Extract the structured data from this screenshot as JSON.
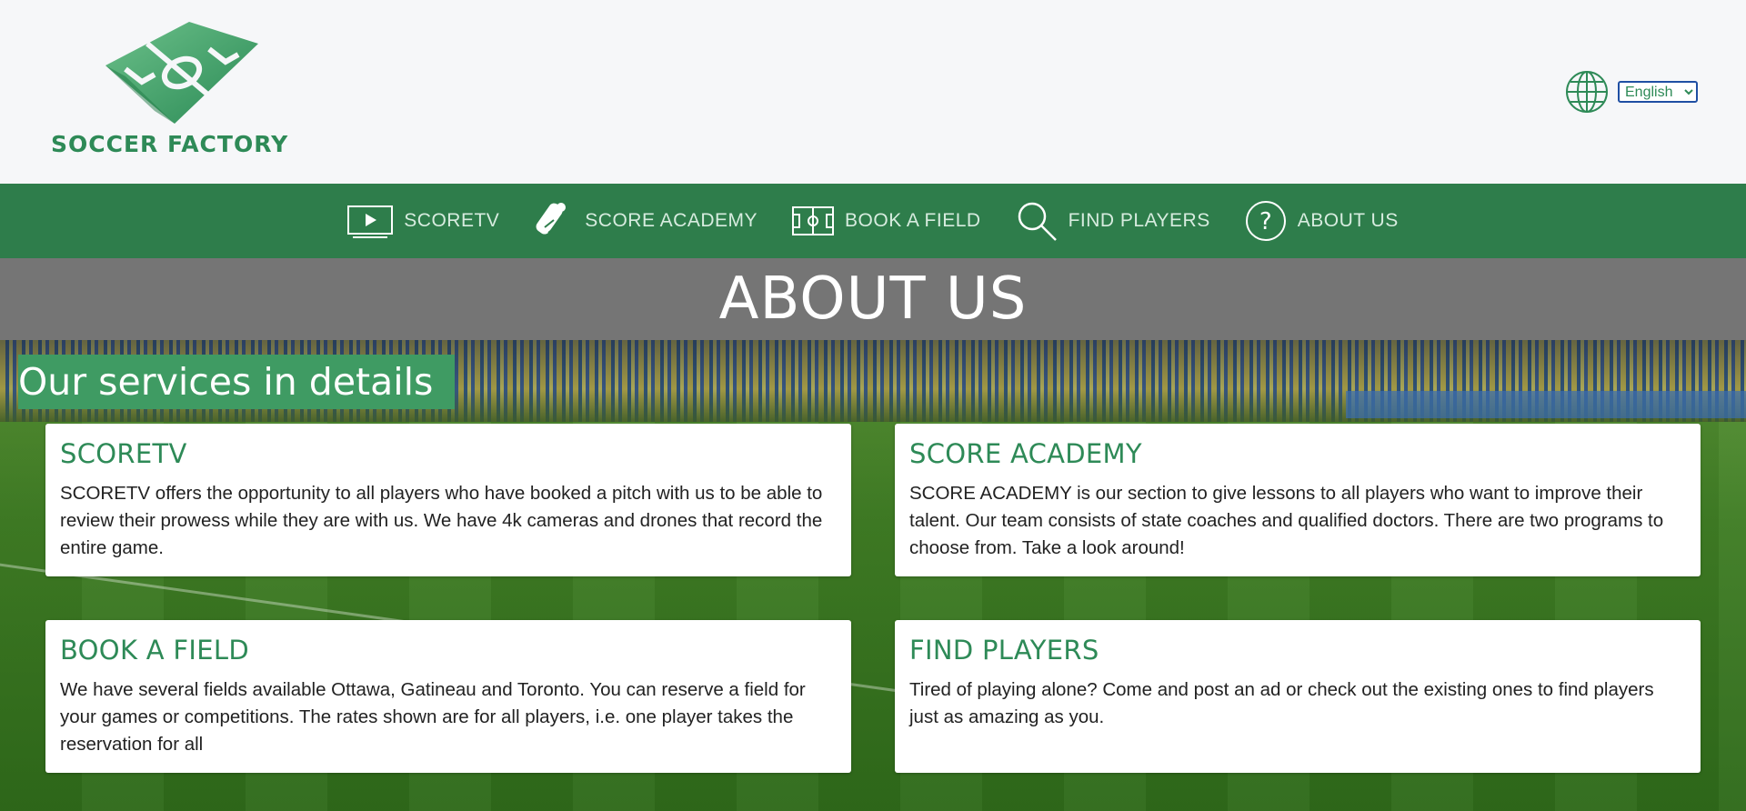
{
  "brand": {
    "name": "SOCCER FACTORY",
    "color": "#2e8a57"
  },
  "language": {
    "icon": "globe-icon",
    "selected": "English",
    "options": [
      "English"
    ]
  },
  "nav": {
    "background": "#2e7d4b",
    "items": [
      {
        "label": "SCORETV",
        "icon": "tv-play-icon"
      },
      {
        "label": "SCORE ACADEMY",
        "icon": "diploma-icon"
      },
      {
        "label": "BOOK A FIELD",
        "icon": "soccer-field-icon"
      },
      {
        "label": "FIND PLAYERS",
        "icon": "magnifier-icon"
      },
      {
        "label": "ABOUT US",
        "icon": "question-circle-icon"
      }
    ]
  },
  "page": {
    "title": "ABOUT US",
    "section_heading": "Our services in details"
  },
  "services": [
    {
      "title": "SCORETV",
      "description": "SCORETV offers the opportunity to all players who have booked a pitch with us to be able to review their prowess while they are with us. We have 4k cameras and drones that record the entire game."
    },
    {
      "title": "SCORE ACADEMY",
      "description": "SCORE ACADEMY is our section to give lessons to all players who want to improve their talent. Our team consists of state coaches and qualified doctors. There are two programs to choose from. Take a look around!"
    },
    {
      "title": "BOOK A FIELD",
      "description": "We have several fields available Ottawa, Gatineau and Toronto. You can reserve a field for your games or competitions. The rates shown are for all players, i.e. one player takes the reservation for all"
    },
    {
      "title": "FIND PLAYERS",
      "description": "Tired of playing alone? Come and post an ad or check out the existing ones to find players just as amazing as you."
    }
  ]
}
